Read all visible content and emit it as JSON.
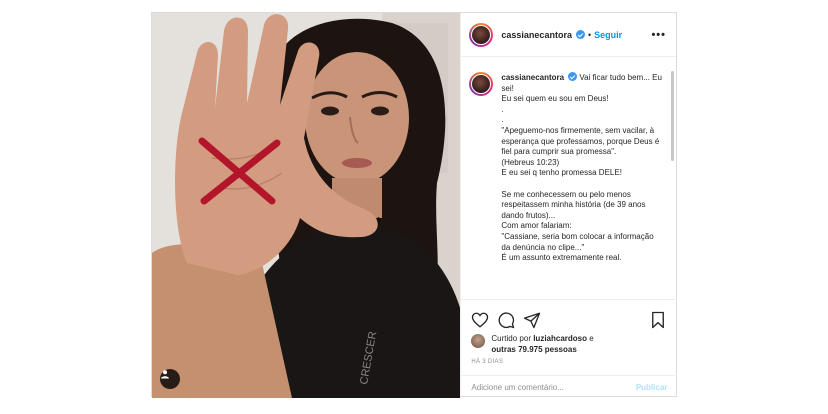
{
  "post": {
    "username": "cassianecantora",
    "follow_label": "Seguir",
    "separator": "•",
    "more_label": "•••",
    "caption": {
      "username": "cassianecantora",
      "text": " Vai ficar tudo bem... Eu sei!\nEu sei quem eu sou em Deus!\n.\n.\n\"Apeguemo-nos firmemente, sem vacilar, à esperança que professamos, porque Deus é fiel para cumprir sua promessa\".\n(Hebreus 10:23)\nE eu sei q tenho promessa DELE!\n\nSe me conhecessem ou pelo menos respeitassem minha história (de 39 anos dando frutos)...\nCom amor falariam:\n\"Cassiane, seria bom colocar a informação da denúncia no clipe...\"\nÉ um assunto extremamente real."
    },
    "likes": {
      "prefix": "Curtido por ",
      "user": "luziahcardoso",
      "middle": " e ",
      "others": "outras 79.975 pessoas"
    },
    "time": "HÁ 3 DIAS",
    "comment_placeholder": "Adicione um comentário...",
    "publish_label": "Publicar"
  },
  "icons": {
    "like": "heart-icon",
    "comment": "comment-icon",
    "share": "share-icon",
    "save": "bookmark-icon",
    "tag": "user-tag-icon"
  },
  "colors": {
    "accent": "#0095f6",
    "verified": "#3897f0",
    "publish_disabled": "#b2dffc",
    "mark": "#b3162a"
  }
}
